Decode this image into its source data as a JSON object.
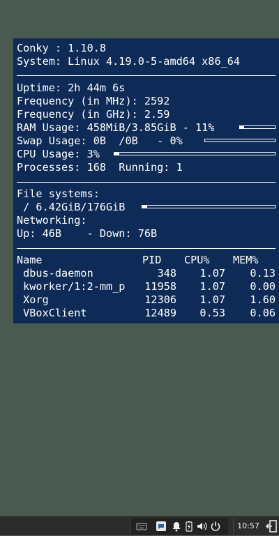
{
  "conky": {
    "line1": "Conky : 1.10.8",
    "line2": "System: Linux 4.19.0-5-amd64 x86_64",
    "uptime": "Uptime: 2h 44m 6s",
    "freq_mhz": "Frequency (in MHz): 2592",
    "freq_ghz": "Frequency (in GHz): 2.59",
    "ram": "RAM Usage: 458MiB/3.85GiB - 11%",
    "ram_pct": 11,
    "swap": "Swap Usage: 0B  /0B   - 0%",
    "swap_pct": 0,
    "cpu": "CPU Usage: 3%",
    "cpu_pct": 3,
    "processes": "Processes: 168  Running: 1",
    "fs_title": "File systems:",
    "fs_root": " / 6.42GiB/176GiB",
    "fs_pct": 3.6,
    "net_title": "Networking:",
    "net_updown": "Up: 46B    - Down: 76B",
    "table_headers": {
      "name": "Name",
      "pid": "PID",
      "cpu": "CPU%",
      "mem": "MEM%"
    },
    "processes_list": [
      {
        "name": " dbus-daemon",
        "pid": "348",
        "cpu": "1.07",
        "mem": "0.13"
      },
      {
        "name": " kworker/1:2-mm_p",
        "pid": "11958",
        "cpu": "1.07",
        "mem": "0.00"
      },
      {
        "name": " Xorg",
        "pid": "12306",
        "cpu": "1.07",
        "mem": "1.60"
      },
      {
        "name": " VBoxClient",
        "pid": "12489",
        "cpu": "0.53",
        "mem": "0.06"
      }
    ]
  },
  "taskbar": {
    "clock": "10:57",
    "icons": [
      "keyboard-icon",
      "chat-icon",
      "bell-icon",
      "battery-icon",
      "volume-icon",
      "power-icon",
      "logout-icon"
    ]
  }
}
